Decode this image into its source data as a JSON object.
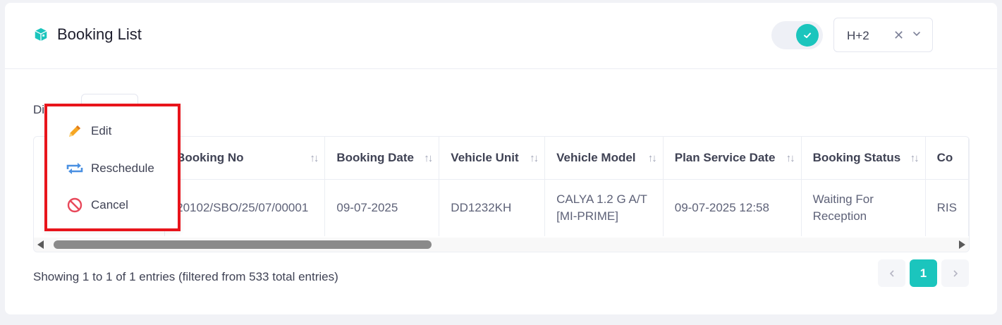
{
  "header": {
    "title": "Booking List",
    "toggle_on": true,
    "filter_value": "H+2",
    "accent_color": "#1bc5bd"
  },
  "controls": {
    "display_label": "Di"
  },
  "table": {
    "columns": [
      "Booking No",
      "Booking Date",
      "Vehicle Unit",
      "Vehicle Model",
      "Plan Service Date",
      "Booking Status",
      "Co"
    ],
    "rows": [
      {
        "booking_no": "20102/SBO/25/07/00001",
        "booking_date": "09-07-2025",
        "vehicle_unit": "DD1232KH",
        "vehicle_model": "CALYA 1.2 G A/T [MI-PRIME]",
        "plan_service_date": "09-07-2025 12:58",
        "booking_status": "Waiting For Reception",
        "co": "RIS"
      }
    ]
  },
  "footer": {
    "info": "Showing 1 to 1 of 1 entries (filtered from 533 total entries)",
    "current_page": "1"
  },
  "context_menu": {
    "items": [
      {
        "label": "Edit",
        "icon": "pencil-icon"
      },
      {
        "label": "Reschedule",
        "icon": "repeat-icon"
      },
      {
        "label": "Cancel",
        "icon": "ban-icon"
      }
    ],
    "highlight_color": "#e8141b"
  }
}
